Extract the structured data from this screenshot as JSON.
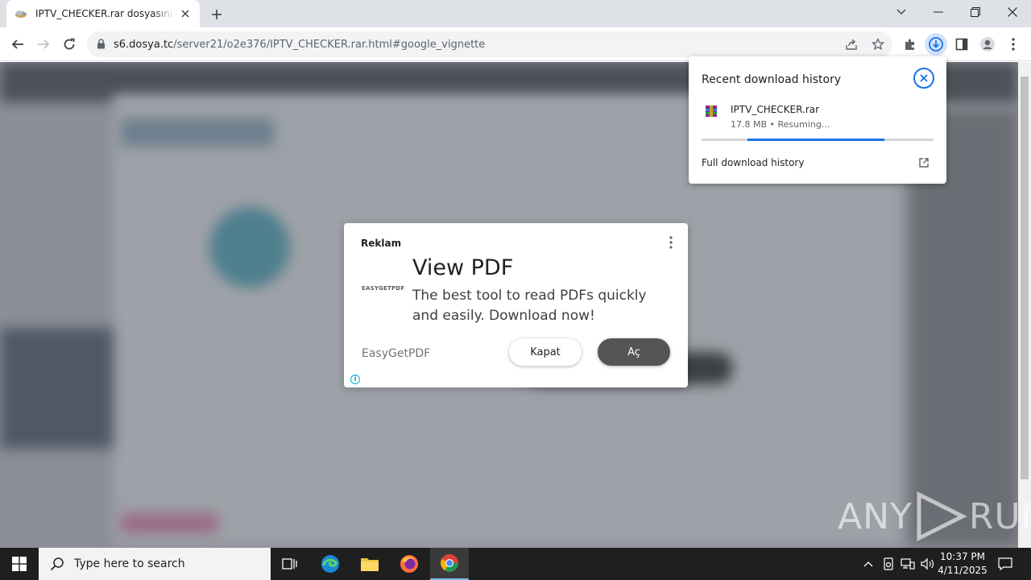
{
  "browser": {
    "tab_title": "IPTV_CHECKER.rar dosyasını indir",
    "url_host": "s6.dosya.tc",
    "url_path": "/server21/o2e376/IPTV_CHECKER.rar.html#google_vignette"
  },
  "ad": {
    "label": "Reklam",
    "logo_text": "EASYGETPDF",
    "headline": "View PDF",
    "description": "The best tool to read PDFs quickly and easily. Download now!",
    "advertiser": "EasyGetPDF",
    "close_label": "Kapat",
    "open_label": "Aç",
    "info_glyph": "i"
  },
  "downloads": {
    "title": "Recent download history",
    "file_name": "IPTV_CHECKER.rar",
    "file_status": "17.8 MB • Resuming...",
    "progress_fraction": 0.59,
    "full_history_label": "Full download history"
  },
  "watermark": {
    "left": "ANY",
    "right": "RUN"
  },
  "taskbar": {
    "search_placeholder": "Type here to search",
    "time": "10:37 PM",
    "date": "4/11/2025"
  },
  "colors": {
    "accent": "#1a73e8",
    "taskbar": "#1f1f1f",
    "ad_open_button": "#555555"
  }
}
